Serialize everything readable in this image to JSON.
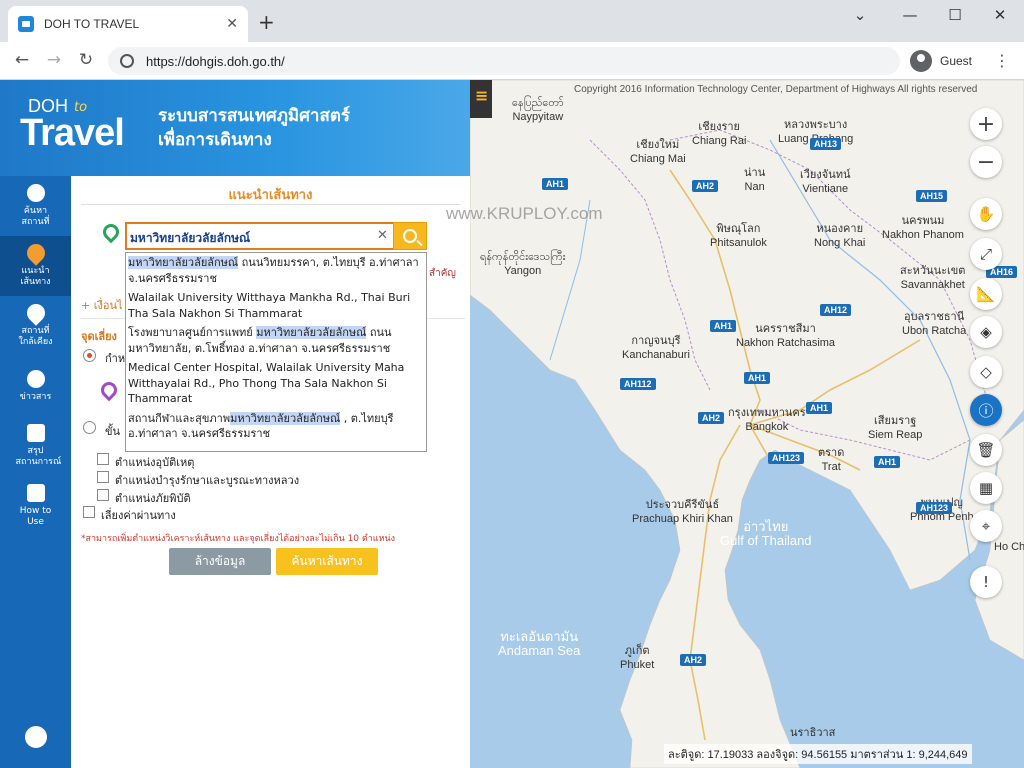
{
  "browser": {
    "tab_title": "DOH TO TRAVEL",
    "url": "https://dohgis.doh.go.th/",
    "profile": "Guest"
  },
  "header": {
    "logo_top": "DOH",
    "logo_to": "to",
    "logo_bottom": "Travel",
    "title_line1": "ระบบสารสนเทศภูมิศาสตร์",
    "title_line2": "เพื่อการเดินทาง"
  },
  "nav": [
    {
      "label": "ค้นหา สถานที่",
      "icon": "search-icon"
    },
    {
      "label": "แนะนำ เส้นทาง",
      "icon": "route-pin-icon"
    },
    {
      "label": "สถานที่ ใกล้เคียง",
      "icon": "location-icon"
    },
    {
      "label": "ข่าวสาร",
      "icon": "bell-icon"
    },
    {
      "label": "สรุป สถานการณ์",
      "icon": "chart-icon"
    },
    {
      "label": "How to Use",
      "icon": "info-icon"
    }
  ],
  "panel": {
    "title": "แนะนำเส้นทาง",
    "search_value": "มหาวิทยาลัยวลัยลักษณ์",
    "right_hint": "สำคัญ",
    "add_condition": "+ เงื่อนไ",
    "section_label": "จุดเลี่ยง",
    "radio1": "กำห",
    "radio2": "ขั้น",
    "checks": [
      "ตำแหน่งอุบัติเหตุ",
      "ตำแหน่งบำรุงรักษาและบูรณะทางหลวง",
      "ตำแหน่งภัยพิบัติ"
    ],
    "toll": "เลี่ยงค่าผ่านทาง",
    "note": "*สามารถเพิ่มตำแหน่งวิเคราะห์เส้นทาง และจุดเลี่ยงได้อย่างละไม่เกิน 10 ตำแหน่ง",
    "btn_clear": "ล้างข้อมูล",
    "btn_route": "ค้นหาเส้นทาง"
  },
  "dropdown": [
    {
      "hl": "มหาวิทยาลัยวลัยลักษณ์",
      "rest": " ถนนวิทยมรรคา, ต.ไทยบุรี อ.ท่าศาลา จ.นครศรีธรรมราช"
    },
    {
      "hl": "",
      "rest": "Walailak University Witthaya Mankha Rd., Thai Buri Tha Sala Nakhon Si Thammarat"
    },
    {
      "pre": "โรงพยาบาลศูนย์การแพทย์ ",
      "hl": "มหาวิทยาลัยวลัยลักษณ์",
      "rest": " ถนนมหาวิทยาลัย, ต.โพธิ์ทอง อ.ท่าศาลา จ.นครศรีธรรมราช"
    },
    {
      "hl": "",
      "rest": "Medical Center Hospital, Walailak University Maha Witthayalai Rd., Pho Thong Tha Sala Nakhon Si Thammarat"
    },
    {
      "pre": "สถานกีฬาและสุขภาพ",
      "hl": "มหาวิทยาลัยวลัยลักษณ์",
      "rest": " , ต.ไทยบุรี อ.ท่าศาลา จ.นครศรีธรรมราช"
    }
  ],
  "watermark": "www.KRUPLOY.com",
  "map": {
    "copyright": "Copyright 2016 Information Technology Center, Department of Highways All rights reserved",
    "coords": "ละติจูด: 17.19033 ลองจิจูด: 94.56155 มาตราส่วน 1: 9,244,649",
    "cities": [
      {
        "name": "နေပြည်တော်\nNaypyitaw"
      },
      {
        "name": "เชียงใหม่\nChiang Mai"
      },
      {
        "name": "เชียงราย\nChiang Rai"
      },
      {
        "name": "หลวงพระบาง\nLuang Prabang"
      },
      {
        "name": "น่าน\nNan"
      },
      {
        "name": "เวียงจันทน์\nVientiane"
      },
      {
        "name": "พิษณุโลก\nPhitsanulok"
      },
      {
        "name": "หนองคาย\nNong Khai"
      },
      {
        "name": "นครพนม\nNakhon Phanom"
      },
      {
        "name": "สะหวันนะเขต\nSavannakhet"
      },
      {
        "name": "ရန်ကုန်တိုင်းဒေသကြီး\nYangon"
      },
      {
        "name": "กาญจนบุรี\nKanchanaburi"
      },
      {
        "name": "นครราชสีมา\nNakhon Ratchasima"
      },
      {
        "name": "อุบลราชธานี\nUbon Ratcha"
      },
      {
        "name": "กรุงเทพมหานคร\nBangkok"
      },
      {
        "name": "เสียมราฐ\nSiem Reap"
      },
      {
        "name": "ตราด\nTrat"
      },
      {
        "name": "ประจวบคีรีขันธ์\nPrachuap Khiri Khan"
      },
      {
        "name": "พนมเปญ\nPhnom Penh"
      },
      {
        "name": "Ho Ch"
      },
      {
        "name": "ภูเก็ต\nPhuket"
      },
      {
        "name": "นราธิวาส"
      }
    ],
    "seas": [
      {
        "name": "อ่าวไทย\nGulf of Thailand"
      },
      {
        "name": "ทะเลอันดามัน\nAndaman Sea"
      }
    ],
    "highways": [
      "AH1",
      "AH2",
      "AH12",
      "AH13",
      "AH15",
      "AH16",
      "AH112",
      "AH123"
    ]
  }
}
